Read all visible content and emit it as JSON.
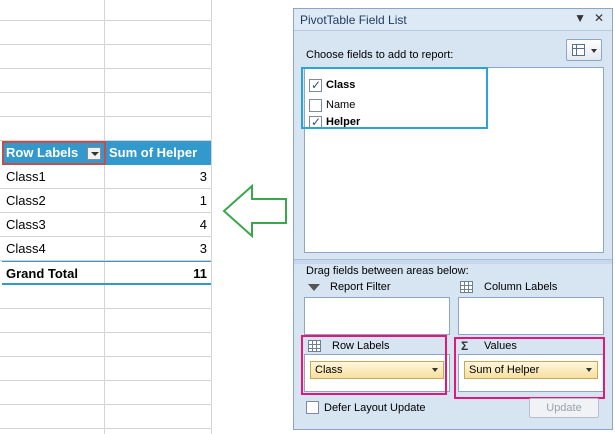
{
  "pivot": {
    "header": {
      "row_labels": "Row Labels",
      "sum_helper": "Sum of Helper"
    },
    "rows": [
      {
        "label": "Class1",
        "value": "3"
      },
      {
        "label": "Class2",
        "value": "1"
      },
      {
        "label": "Class3",
        "value": "4"
      },
      {
        "label": "Class4",
        "value": "3"
      }
    ],
    "total": {
      "label": "Grand Total",
      "value": "11"
    }
  },
  "fieldlist": {
    "title": "PivotTable Field List",
    "choose_label": "Choose fields to add to report:",
    "fields": [
      {
        "name": "Class",
        "checked": true
      },
      {
        "name": "Name",
        "checked": false
      },
      {
        "name": "Helper",
        "checked": true
      }
    ],
    "drag_label": "Drag fields between areas below:",
    "areas": {
      "report_filter": "Report Filter",
      "column_labels": "Column Labels",
      "row_labels": "Row Labels",
      "values": "Values"
    },
    "row_labels_item": "Class",
    "values_item": "Sum of Helper",
    "defer_label": "Defer Layout Update",
    "update_label": "Update",
    "icons": {
      "close": "close-icon",
      "menu": "chevron-down-icon",
      "filter": "funnel-icon",
      "grid": "grid-icon",
      "sigma": "sigma-icon"
    },
    "colors": {
      "highlight_fields": "#2ba3d8",
      "highlight_areas": "#e0187a",
      "header_fill": "#3399cc",
      "arrow": "#3aa84a"
    }
  }
}
